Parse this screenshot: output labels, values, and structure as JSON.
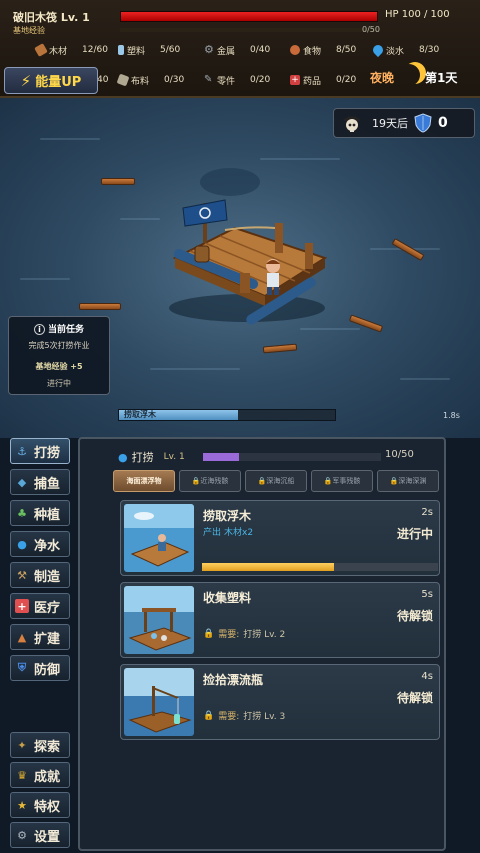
{
  "header": {
    "title": "破旧木筏  Lv. 1",
    "hp_text": "HP 100 / 100",
    "hp_fraction": 1.0,
    "exp_label": "基地经验",
    "exp_text": "0/50",
    "exp_fraction": 0.0
  },
  "resources": [
    {
      "name": "木材",
      "value": "12/60",
      "icon": "wood-icon",
      "color": "#b8743a"
    },
    {
      "name": "塑料",
      "value": "5/60",
      "icon": "plastic-bottle-icon",
      "color": "#9cc8e8"
    },
    {
      "name": "金属",
      "value": "0/40",
      "icon": "gear-icon",
      "color": "#9aa0a8"
    },
    {
      "name": "食物",
      "value": "8/50",
      "icon": "meat-icon",
      "color": "#c86a3a"
    },
    {
      "name": "淡水",
      "value": "8/30",
      "icon": "water-drop-icon",
      "color": "#3aa0e8"
    },
    {
      "name": "",
      "value": "40",
      "icon": "blank-icon",
      "color": "#1c160f"
    },
    {
      "name": "布料",
      "value": "0/30",
      "icon": "cloth-icon",
      "color": "#b0a890"
    },
    {
      "name": "零件",
      "value": "0/20",
      "icon": "wrench-icon",
      "color": "#a0a8b0"
    },
    {
      "name": "药品",
      "value": "0/20",
      "icon": "medkit-icon",
      "color": "#d04040"
    }
  ],
  "energy_button": "能量UP",
  "time_of_day": "夜晚",
  "day_label": "第1天",
  "threat": {
    "days_text": "19天后",
    "defense": "0"
  },
  "task": {
    "title": "当前任务",
    "description": "完成5次打捞作业",
    "reward": "基地经验 +5",
    "status": "进行中"
  },
  "action_progress": {
    "label": "捞取浮木",
    "time": "1.8s",
    "fraction": 0.55
  },
  "nav": {
    "main": [
      {
        "label": "打捞",
        "icon": "anchor-icon",
        "color": "#6ab0e8"
      },
      {
        "label": "捕鱼",
        "icon": "fish-icon",
        "color": "#5aa8d8"
      },
      {
        "label": "种植",
        "icon": "sprout-icon",
        "color": "#6ac060"
      },
      {
        "label": "净水",
        "icon": "water-drop-icon",
        "color": "#3aa0e8"
      },
      {
        "label": "制造",
        "icon": "hammer-icon",
        "color": "#c8a060"
      },
      {
        "label": "医疗",
        "icon": "medkit-icon",
        "color": "#e05050"
      },
      {
        "label": "扩建",
        "icon": "build-icon",
        "color": "#d88040"
      },
      {
        "label": "防御",
        "icon": "shield-icon",
        "color": "#4a8ae0"
      }
    ],
    "bottom": [
      {
        "label": "探索",
        "icon": "compass-icon",
        "color": "#c8a048"
      },
      {
        "label": "成就",
        "icon": "trophy-icon",
        "color": "#e0b030"
      },
      {
        "label": "特权",
        "icon": "star-icon",
        "color": "#e8b838"
      },
      {
        "label": "设置",
        "icon": "gear-icon",
        "color": "#b0b8c0"
      }
    ]
  },
  "skill": {
    "name": "打捞",
    "level": "Lv. 1",
    "count": "10/50",
    "fraction": 0.2
  },
  "tabs": [
    "海面漂浮物",
    "近海残骸",
    "深海沉船",
    "军事残骸",
    "深海深渊"
  ],
  "actions": [
    {
      "title": "捞取浮木",
      "time": "2s",
      "produce_label": "产出",
      "produce_value": "木材x2",
      "status": "进行中",
      "progress": 0.56
    },
    {
      "title": "收集塑料",
      "time": "5s",
      "req_label": "需要:",
      "req_value": "打捞 Lv. 2",
      "status": "待解锁"
    },
    {
      "title": "捡拾漂流瓶",
      "time": "4s",
      "req_label": "需要:",
      "req_value": "打捞 Lv. 3",
      "status": "待解锁"
    }
  ]
}
